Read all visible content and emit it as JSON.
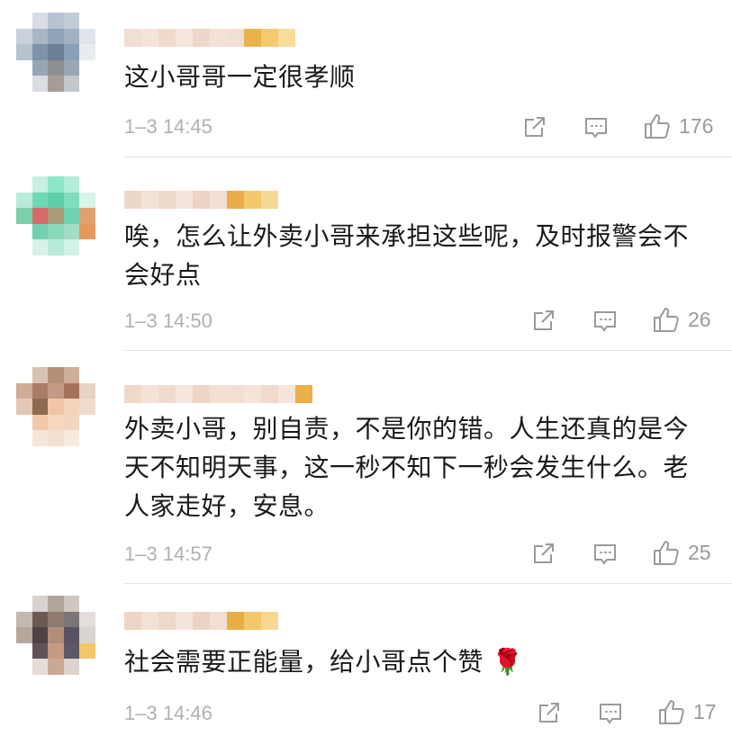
{
  "comments": [
    {
      "text": "这小哥哥一定很孝顺",
      "time": "1–3 14:45",
      "likes": "176"
    },
    {
      "text": "唉，怎么让外卖小哥来承担这些呢，及时报警会不会好点",
      "time": "1–3 14:50",
      "likes": "26"
    },
    {
      "text": "外卖小哥，别自责，不是你的错。人生还真的是今天不知明天事，这一秒不知下一秒会发生什么。老人家走好，安息。",
      "time": "1–3 14:57",
      "likes": "25"
    },
    {
      "text": "社会需要正能量，给小哥点个赞 🌹",
      "time": "1–3 14:46",
      "likes": "17"
    }
  ],
  "icons": {
    "share": "share-icon",
    "reply": "comment-icon",
    "like": "thumbs-up-icon"
  },
  "colors": {
    "text": "#1a1a1a",
    "meta": "#b0b0b0",
    "icon": "#9a9a9a",
    "divider": "#e6e6e6"
  }
}
